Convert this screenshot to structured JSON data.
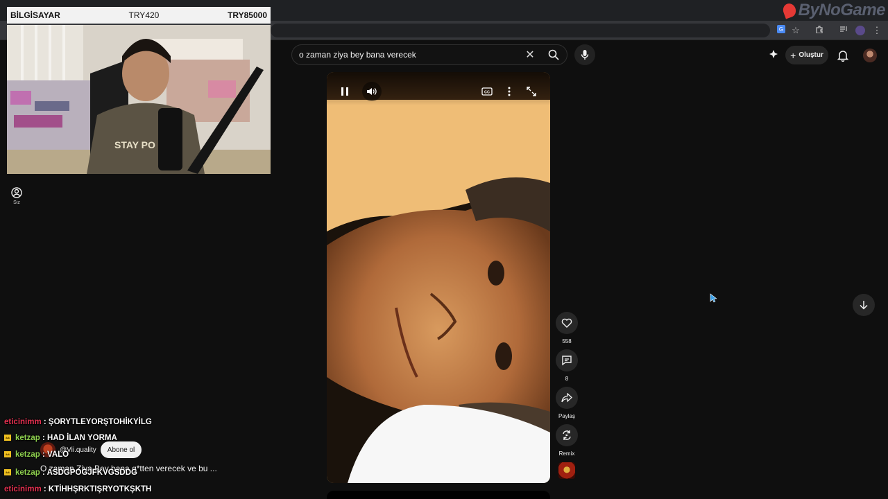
{
  "browser": {
    "brand_text": "ByNoGame"
  },
  "overlay": {
    "balance_name": "BİLGİSAYAR",
    "balance_mid": "TRY420",
    "balance_right": "TRY85000"
  },
  "youtube": {
    "search_value": "o zaman ziya bey bana verecek",
    "create_label": "Oluştur",
    "nav_you_label": "Siz"
  },
  "short": {
    "likes": "558",
    "comments": "8",
    "share_label": "Paylaş",
    "remix_label": "Remix",
    "channel": "@Vii.quality",
    "subscribe_label": "Abone ol",
    "title": "O zaman Ziya Bey bana g*tten verecek ve bu ..."
  },
  "chat": [
    {
      "user": "eticinimm",
      "text": ": ŞORYTLEYORŞTOHİKYİLG",
      "color": "red",
      "badge": false
    },
    {
      "user": "ketzap",
      "text": ": HAD İLAN YORMA",
      "color": "green",
      "badge": true
    },
    {
      "user": "ketzap",
      "text": ": VALO",
      "color": "green",
      "badge": true
    },
    {
      "user": "ketzap",
      "text": ": ASDGPOGJFKVGSDDG",
      "color": "green",
      "badge": true
    },
    {
      "user": "eticinimm",
      "text": ": KTİHHŞRKTIŞRYOTKŞKTH",
      "color": "red",
      "badge": false
    }
  ],
  "colors": {
    "background": "#0f0f0f",
    "chat_red": "#e53050",
    "chat_green": "#8fd14f",
    "badge_gold": "#f0c020"
  }
}
